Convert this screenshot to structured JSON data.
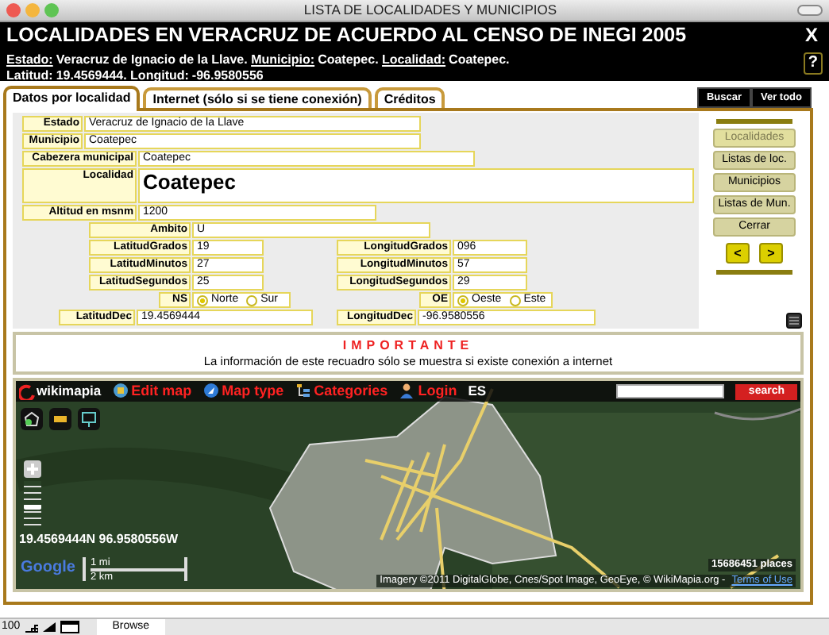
{
  "window": {
    "title": "LISTA DE LOCALIDADES Y MUNICIPIOS"
  },
  "header": {
    "title": "LOCALIDADES EN VERACRUZ  DE ACUERDO AL CENSO DE INEGI 2005",
    "close_button": "X",
    "help_button": "?",
    "summary_lines": [
      [
        {
          "label": "Estado:",
          "value": "Veracruz de Ignacio de la Llave."
        },
        {
          "label": "Municipio:",
          "value": "Coatepec."
        },
        {
          "label": "Localidad:",
          "value": "Coatepec."
        }
      ],
      [
        {
          "label": "Latitud:",
          "value": "19.4569444."
        },
        {
          "label": "Longitud:",
          "value": "-96.9580556"
        }
      ]
    ]
  },
  "tabs": [
    {
      "label": "Datos por localidad",
      "selected": true
    },
    {
      "label": "Internet (sólo si se tiene conexión)",
      "selected": false
    },
    {
      "label": "Créditos",
      "selected": false
    }
  ],
  "top_buttons": [
    "Buscar",
    "Ver todo"
  ],
  "form_rows": [
    {
      "fields": [
        {
          "kind": "text",
          "label": "Estado",
          "value": "Veracruz de Ignacio de la Llave"
        }
      ]
    },
    {
      "fields": [
        {
          "kind": "text",
          "label": "Municipio",
          "value": "Coatepec"
        }
      ]
    },
    {
      "fields": [
        {
          "kind": "text",
          "label": "Cabezera municipal",
          "value": "Coatepec"
        }
      ]
    },
    {
      "fields": [
        {
          "kind": "large",
          "label": "Localidad",
          "value": "Coatepec"
        }
      ]
    },
    {
      "fields": [
        {
          "kind": "text",
          "label": "Altitud en msnm",
          "value": "1200"
        }
      ]
    },
    {
      "fields": [
        {
          "kind": "text",
          "label": "Ambito",
          "value": "U"
        }
      ]
    },
    {
      "fields": [
        {
          "kind": "text",
          "label": "LatitudGrados",
          "value": "19"
        },
        {
          "kind": "text",
          "label": "LongitudGrados",
          "value": "096"
        }
      ]
    },
    {
      "fields": [
        {
          "kind": "text",
          "label": "LatitudMinutos",
          "value": "27"
        },
        {
          "kind": "text",
          "label": "LongitudMinutos",
          "value": "57"
        }
      ]
    },
    {
      "fields": [
        {
          "kind": "text",
          "label": "LatitudSegundos",
          "value": "25"
        },
        {
          "kind": "text",
          "label": "LongitudSegundos",
          "value": "29"
        }
      ]
    },
    {
      "fields": [
        {
          "kind": "radio",
          "label": "NS",
          "options": [
            {
              "label": "Norte",
              "selected": true
            },
            {
              "label": "Sur",
              "selected": false
            }
          ]
        },
        {
          "kind": "radio",
          "label": "OE",
          "options": [
            {
              "label": "Oeste",
              "selected": true
            },
            {
              "label": "Este",
              "selected": false
            }
          ]
        }
      ]
    },
    {
      "fields": [
        {
          "kind": "text",
          "label": "LatitudDec",
          "value": "19.4569444"
        },
        {
          "kind": "text",
          "label": "LongitudDec",
          "value": "-96.9580556"
        }
      ]
    }
  ],
  "side_buttons": [
    {
      "label": "Localidades",
      "disabled": true
    },
    {
      "label": "Listas de loc.",
      "disabled": false
    },
    {
      "label": "Municipios",
      "disabled": false
    },
    {
      "label": "Listas de Mun.",
      "disabled": false
    },
    {
      "label": "Cerrar",
      "disabled": false
    }
  ],
  "nav_buttons": [
    "<",
    ">"
  ],
  "notice": {
    "title": "IMPORTANTE",
    "text": "La información de este recuadro sólo se muestra si existe conexión a internet"
  },
  "map": {
    "logo": "wikimapia",
    "links": [
      {
        "kind": "edit",
        "label": "Edit map"
      },
      {
        "kind": "maptype",
        "label": "Map type"
      },
      {
        "kind": "categories",
        "label": "Categories"
      },
      {
        "kind": "login",
        "label": "Login"
      }
    ],
    "language": "ES",
    "search_button": "search",
    "zoom_slider": {
      "level": 0.45
    },
    "coordinates": "19.4569444N 96.9580556W",
    "scale": [
      "1 mi",
      "2 km"
    ],
    "provider_logo": "Google",
    "places": "15686451 places",
    "attribution": "Imagery ©2011 DigitalGlobe, Cnes/Spot Image, GeoEye, © WikiMapia.org -",
    "terms_link": "Terms of Use"
  },
  "status_bar": {
    "zoom": "100",
    "mode": "Browse"
  }
}
